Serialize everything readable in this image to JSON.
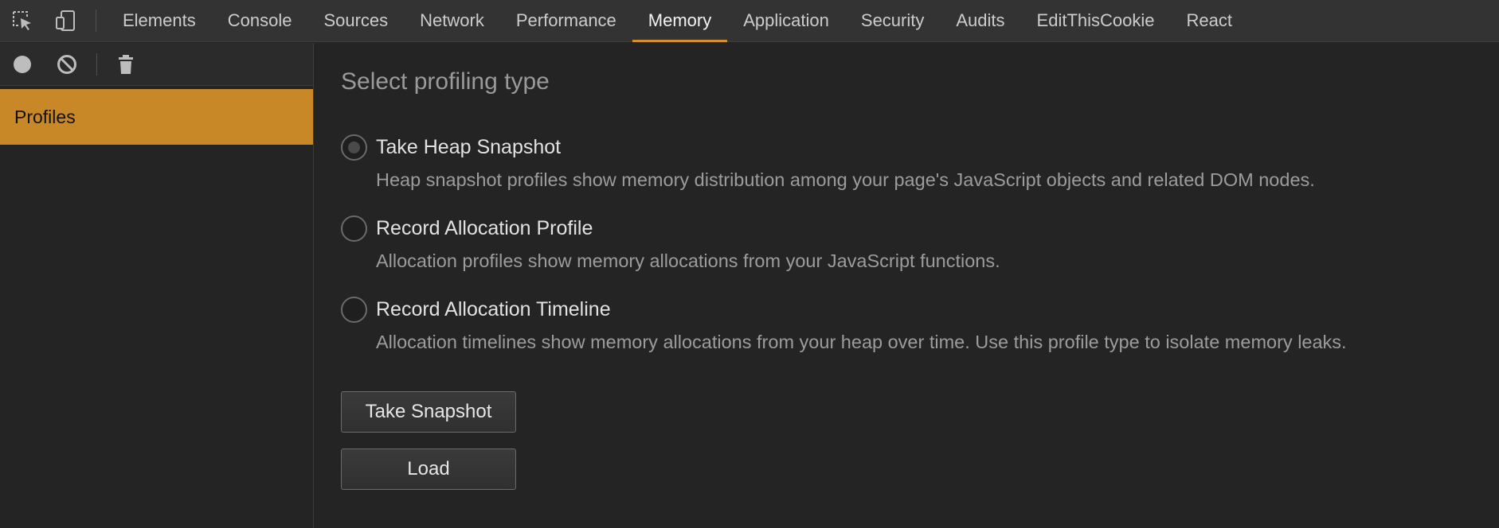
{
  "tabbar": {
    "tabs": [
      {
        "label": "Elements"
      },
      {
        "label": "Console"
      },
      {
        "label": "Sources"
      },
      {
        "label": "Network"
      },
      {
        "label": "Performance"
      },
      {
        "label": "Memory",
        "active": true
      },
      {
        "label": "Application"
      },
      {
        "label": "Security"
      },
      {
        "label": "Audits"
      },
      {
        "label": "EditThisCookie"
      },
      {
        "label": "React"
      }
    ],
    "icons": [
      "inspect-element-icon",
      "device-toolbar-icon"
    ]
  },
  "sidebar": {
    "toolbar_icons": [
      "record-icon",
      "clear-icon",
      "trash-icon"
    ],
    "items": [
      {
        "label": "Profiles",
        "selected": true
      }
    ]
  },
  "main": {
    "heading": "Select profiling type",
    "options": [
      {
        "title": "Take Heap Snapshot",
        "description": "Heap snapshot profiles show memory distribution among your page's JavaScript objects and related DOM nodes.",
        "selected": true
      },
      {
        "title": "Record Allocation Profile",
        "description": "Allocation profiles show memory allocations from your JavaScript functions.",
        "selected": false
      },
      {
        "title": "Record Allocation Timeline",
        "description": "Allocation timelines show memory allocations from your heap over time. Use this profile type to isolate memory leaks.",
        "selected": false
      }
    ],
    "buttons": {
      "take_snapshot": "Take Snapshot",
      "load": "Load"
    }
  },
  "colors": {
    "accent": "#c88828",
    "tab_underline": "#d4912c",
    "background": "#242424",
    "toolbar": "#333333"
  }
}
